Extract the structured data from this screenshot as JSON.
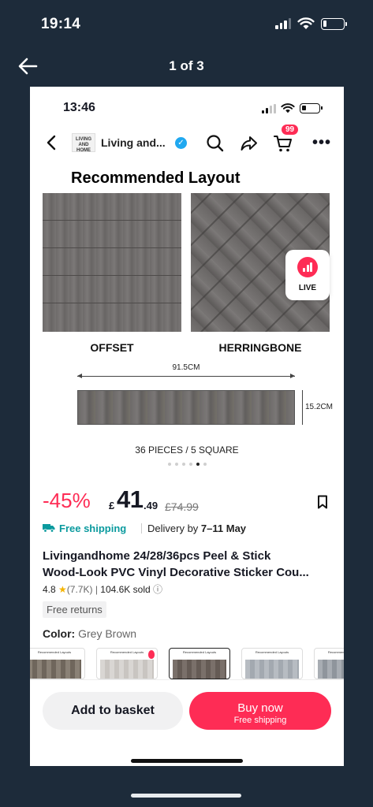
{
  "os_status": {
    "time": "19:14"
  },
  "viewer": {
    "counter": "1 of 3"
  },
  "inner_status": {
    "time": "13:46"
  },
  "nav": {
    "shop_logo_text": "LIVING AND HOME",
    "shop_name": "Living and...",
    "cart_count": "99",
    "more_label": "•••"
  },
  "hero": {
    "title": "Recommended Layout",
    "live_label": "LIVE",
    "tile_labels": [
      "OFFSET",
      "HERRINGBONE"
    ],
    "width_dim": "91.5CM",
    "height_dim": "15.2CM",
    "pieces_text": "36 PIECES / 5 SQUARE",
    "carousel": {
      "total": 6,
      "active_index": 4
    }
  },
  "price": {
    "discount": "-45%",
    "currency": "£",
    "whole": "41",
    "decimal": ".49",
    "original": "£74.99"
  },
  "shipping": {
    "free_label": "Free shipping",
    "delivery_prefix": "Delivery by ",
    "delivery_dates": "7–11 May"
  },
  "product": {
    "title_line1": "Livingandhome 24/28/36pcs Peel & Stick",
    "title_line2": "Wood-Look PVC Vinyl Decorative Sticker Cou...",
    "rating": "4.8",
    "reviews": "(7.7K)",
    "sold": "104.6K sold"
  },
  "badges": {
    "free_returns": "Free returns"
  },
  "color": {
    "label": "Color: ",
    "value": "Grey Brown",
    "swatch_caption": "Recommended Layouts",
    "selected_index": 2
  },
  "actions": {
    "add_to_basket": "Add to basket",
    "buy_now": "Buy now",
    "buy_now_sub": "Free shipping"
  },
  "colors": {
    "brand": "#fe2c55",
    "shipping": "#0a9a9e",
    "outer_bg": "#1d2b3a"
  }
}
